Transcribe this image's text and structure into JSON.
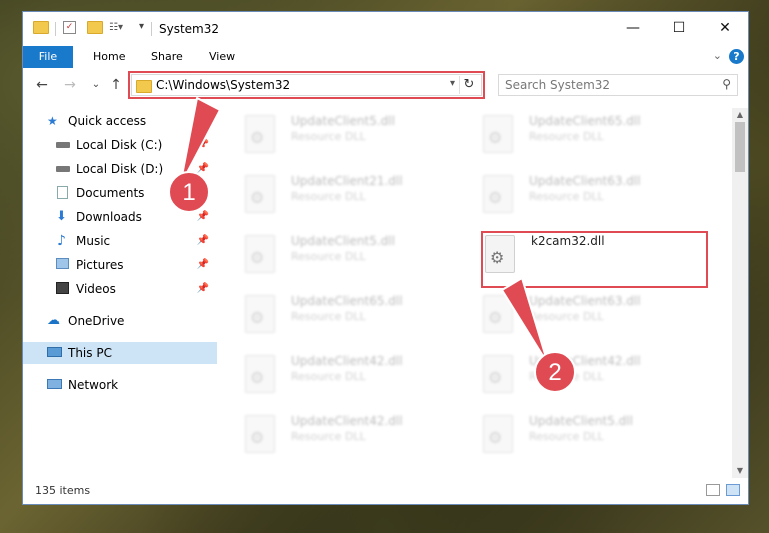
{
  "window": {
    "title": "System32",
    "controls": {
      "minimize": "—",
      "maximize": "☐",
      "close": "✕"
    }
  },
  "ribbon": {
    "tabs": [
      "File",
      "Home",
      "Share",
      "View"
    ],
    "expand_icon": "chevron-down-icon",
    "help_label": "?"
  },
  "address_bar": {
    "path": "C:\\Windows\\System32",
    "nav_back": "←",
    "nav_forward": "→",
    "nav_recent": "⌄",
    "nav_up": "↑",
    "refresh": "↻"
  },
  "search": {
    "placeholder": "Search System32"
  },
  "sidebar": {
    "items": [
      {
        "label": "Quick access",
        "icon": "star-icon",
        "pinned": false
      },
      {
        "label": "Local Disk (C:)",
        "icon": "drive-icon",
        "pinned": true
      },
      {
        "label": "Local Disk (D:)",
        "icon": "drive-icon",
        "pinned": true
      },
      {
        "label": "Documents",
        "icon": "documents-icon",
        "pinned": true
      },
      {
        "label": "Downloads",
        "icon": "download-icon",
        "pinned": true
      },
      {
        "label": "Music",
        "icon": "music-icon",
        "pinned": true
      },
      {
        "label": "Pictures",
        "icon": "pictures-icon",
        "pinned": true
      },
      {
        "label": "Videos",
        "icon": "videos-icon",
        "pinned": true
      },
      {
        "label": "OneDrive",
        "icon": "cloud-icon",
        "pinned": false
      },
      {
        "label": "This PC",
        "icon": "computer-icon",
        "pinned": false,
        "selected": true
      },
      {
        "label": "Network",
        "icon": "network-icon",
        "pinned": false
      }
    ]
  },
  "files": [
    {
      "name": "UpdateClient5.dll",
      "type": "Resource DLL"
    },
    {
      "name": "UpdateClient65.dll",
      "type": "Resource DLL"
    },
    {
      "name": "UpdateClient21.dll",
      "type": "Resource DLL"
    },
    {
      "name": "UpdateClient63.dll",
      "type": "Resource DLL"
    },
    {
      "name": "UpdateClient5.dll",
      "type": "Resource DLL"
    },
    {
      "name": "k2cam32.dll",
      "type": ""
    },
    {
      "name": "UpdateClient65.dll",
      "type": "Resource DLL"
    },
    {
      "name": "UpdateClient63.dll",
      "type": "Resource DLL"
    },
    {
      "name": "UpdateClient42.dll",
      "type": "Resource DLL"
    },
    {
      "name": "UpdateClient42.dll",
      "type": "Resource DLL"
    },
    {
      "name": "UpdateClient42.dll",
      "type": "Resource DLL"
    },
    {
      "name": "UpdateClient5.dll",
      "type": "Resource DLL"
    }
  ],
  "status": {
    "item_count": "135 items"
  },
  "annotations": {
    "step1": "1",
    "step2": "2",
    "color": "#e04a53"
  }
}
